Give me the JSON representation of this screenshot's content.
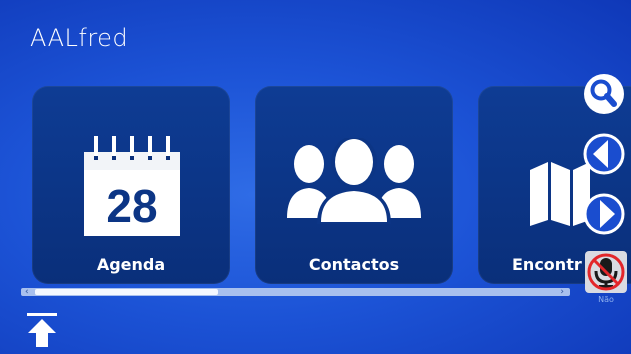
{
  "app": {
    "title": "AALfred"
  },
  "tiles": [
    {
      "label": "Agenda",
      "icon": "calendar-icon",
      "calendar_day": "28"
    },
    {
      "label": "Contactos",
      "icon": "people-icon"
    },
    {
      "label": "Encontr",
      "icon": "map-icon"
    }
  ],
  "sidebar": {
    "search": {
      "icon": "search-icon"
    },
    "previous": {
      "icon": "chevron-left-icon"
    },
    "next": {
      "icon": "chevron-right-icon"
    },
    "mic": {
      "icon": "mic-off-icon",
      "caption": "Não"
    }
  },
  "scroll": {
    "left_arrow": "‹",
    "right_arrow": "›",
    "position": 0.0
  },
  "footer": {
    "up": {
      "icon": "arrow-up-icon"
    }
  },
  "colors": {
    "background": "#1c53d6",
    "tile": "#0c3585",
    "text": "#ffffff",
    "mic_disabled": "#e3262a"
  }
}
